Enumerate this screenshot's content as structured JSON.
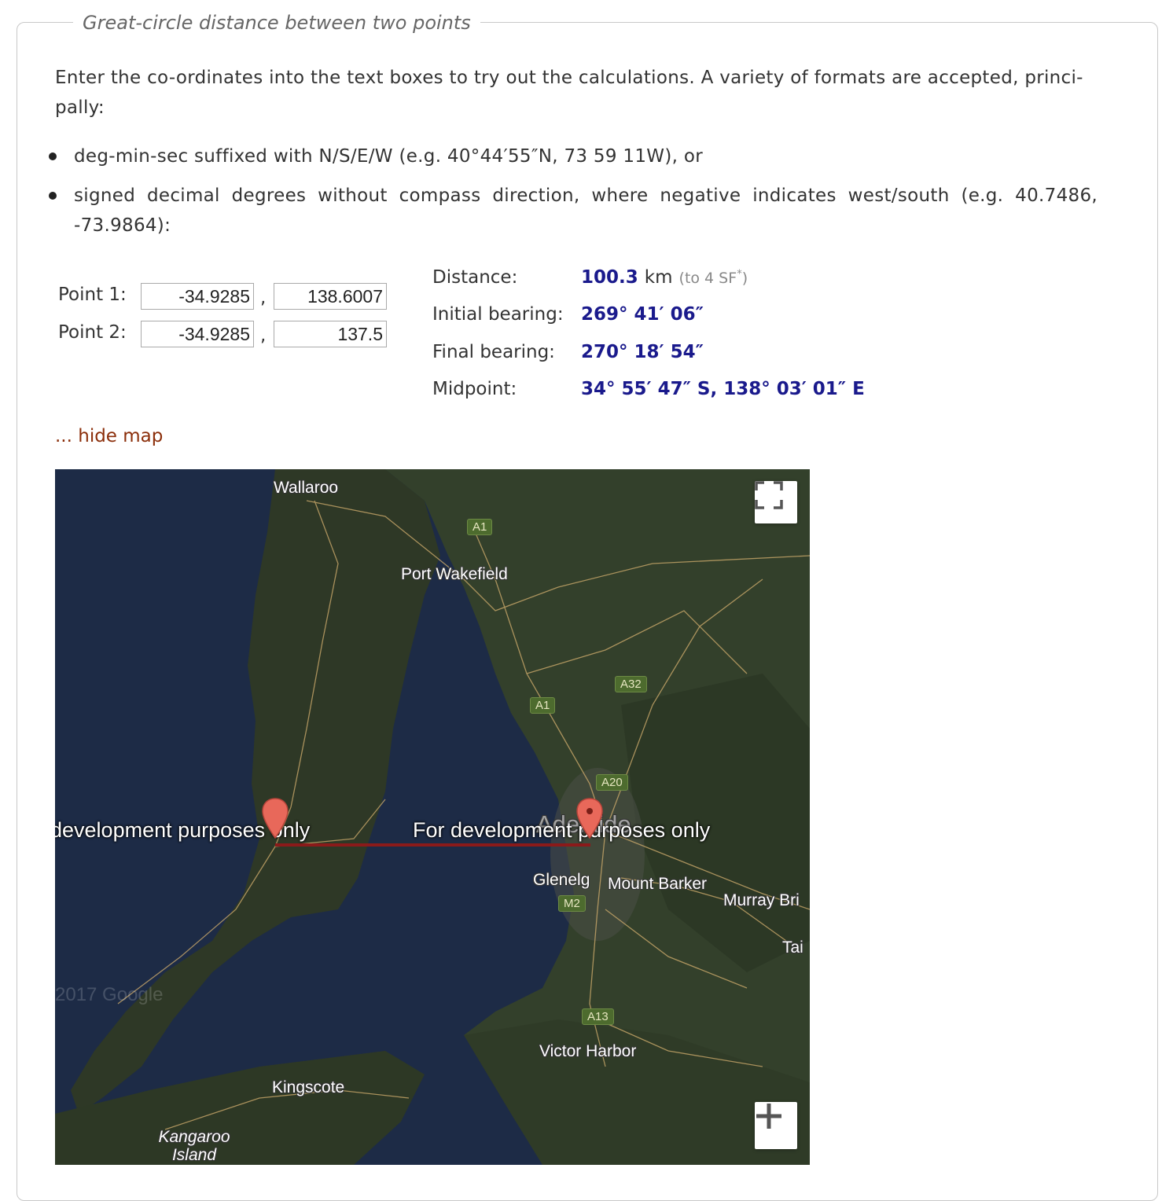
{
  "legend": "Great-circle distance between two points",
  "intro": "Enter the co-ordinates into the text boxes to try out the calculations. A variety of formats are accepted, princi- pally:",
  "bullets": [
    "deg-min-sec suffixed with N/S/E/W (e.g. 40°44′55″N, 73 59 11W), or",
    "signed decimal degrees without compass direction, where negative indicates west/south (e.g. 40.7486, -73.9864):"
  ],
  "inputs": {
    "point1": {
      "label": "Point 1:",
      "lat": "-34.9285",
      "lon": "138.6007"
    },
    "point2": {
      "label": "Point 2:",
      "lat": "-34.9285",
      "lon": "137.5"
    },
    "separator": ","
  },
  "results": {
    "distance": {
      "label": "Distance:",
      "value": "100.3",
      "unit": "km",
      "note": "(to 4 SF",
      "note_mark": "*",
      "note_close": ")"
    },
    "initial_bearing": {
      "label": "Initial bearing:",
      "value": "269° 41′ 06″"
    },
    "final_bearing": {
      "label": "Final bearing:",
      "value": "270° 18′ 54″"
    },
    "midpoint": {
      "label": "Midpoint:",
      "value": "34° 55′ 47″ S, 138° 03′ 01″ E"
    }
  },
  "hide_map": "... hide map",
  "map": {
    "places": {
      "wallaroo": "Wallaroo",
      "port_wakefield": "Port Wakefield",
      "adelaide": "Adelaide",
      "glenelg": "Glenelg",
      "mount_barker": "Mount Barker",
      "murray_bridge": "Murray Bri",
      "tailem": "Tai",
      "victor_harbor": "Victor Harbor",
      "kingscote": "Kingscote",
      "kangaroo_island": "Kangaroo Island"
    },
    "roads": [
      "A1",
      "A1",
      "A32",
      "A20",
      "M2",
      "A13"
    ],
    "dev_text_left": "development purposes only",
    "dev_text_right": "For development purposes only",
    "watermark": "2017 Google",
    "colors": {
      "sea": "#1c2a44",
      "land": "#2f3a28",
      "route": "#8b1a1a",
      "marker": "#e8685a"
    }
  },
  "icons": {
    "fullscreen": "fullscreen-icon",
    "zoom_in": "plus-icon",
    "marker": "map-marker-icon"
  }
}
